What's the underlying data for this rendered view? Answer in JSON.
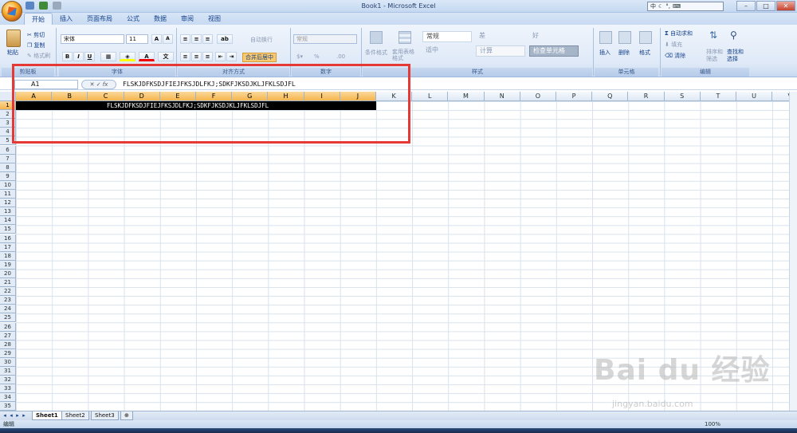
{
  "window": {
    "title": "Book1 - Microsoft Excel"
  },
  "ribbon_tabs": [
    "开始",
    "插入",
    "页面布局",
    "公式",
    "数据",
    "审阅",
    "视图"
  ],
  "clipboard": {
    "paste": "粘贴",
    "cut": "剪切",
    "copy": "复制",
    "format_painter": "格式刷",
    "group": "剪贴板"
  },
  "font": {
    "name": "宋体",
    "size": "11",
    "bold": "B",
    "italic": "I",
    "underline": "U",
    "group": "字体"
  },
  "alignment": {
    "wrap": "自动换行",
    "merge": "合并后居中",
    "group": "对齐方式"
  },
  "number": {
    "format": "常规",
    "percent": "%",
    "group": "数字"
  },
  "styles": {
    "conditional": "条件格式",
    "table": "套用表格格式",
    "normal": "常规",
    "bad": "差",
    "good": "好",
    "neutral": "适中",
    "calc": "计算",
    "check": "检查单元格",
    "group": "样式"
  },
  "cells": {
    "insert": "插入",
    "delete": "删除",
    "format": "格式",
    "group": "单元格"
  },
  "editing": {
    "autosum": "自动求和",
    "fill": "填充",
    "clear": "清除",
    "sort": "排序和筛选",
    "find": "查找和选择",
    "group": "编辑"
  },
  "formula_bar": {
    "cell_ref": "A1",
    "fx": "fx",
    "content": "FLSKJDFKSDJFIEJFKSJDLFKJ;SDKFJKSDJKLJFKLSDJFL"
  },
  "columns": [
    "A",
    "B",
    "C",
    "D",
    "E",
    "F",
    "G",
    "H",
    "I",
    "J",
    "K",
    "L",
    "M",
    "N",
    "O",
    "P",
    "Q",
    "R",
    "S",
    "T",
    "U",
    "V"
  ],
  "rows": [
    "1",
    "2",
    "3",
    "4",
    "5",
    "6",
    "7",
    "8",
    "9",
    "10",
    "11",
    "12",
    "13",
    "14",
    "15",
    "16",
    "17",
    "18",
    "19",
    "20",
    "21",
    "22",
    "23",
    "24",
    "25",
    "26",
    "27",
    "28",
    "29",
    "30",
    "31",
    "32",
    "33",
    "34",
    "35"
  ],
  "cell_a1": "FLSKJDFKSDJFIEJFKSJDLFKJ;SDKFJKSDJKLJFKLSDJFL",
  "sheets": [
    "Sheet1",
    "Sheet2",
    "Sheet3"
  ],
  "status": {
    "mode": "编辑",
    "zoom": "100%"
  },
  "watermark": {
    "brand": "Bai du 经验",
    "url": "jingyan.baidu.com"
  }
}
